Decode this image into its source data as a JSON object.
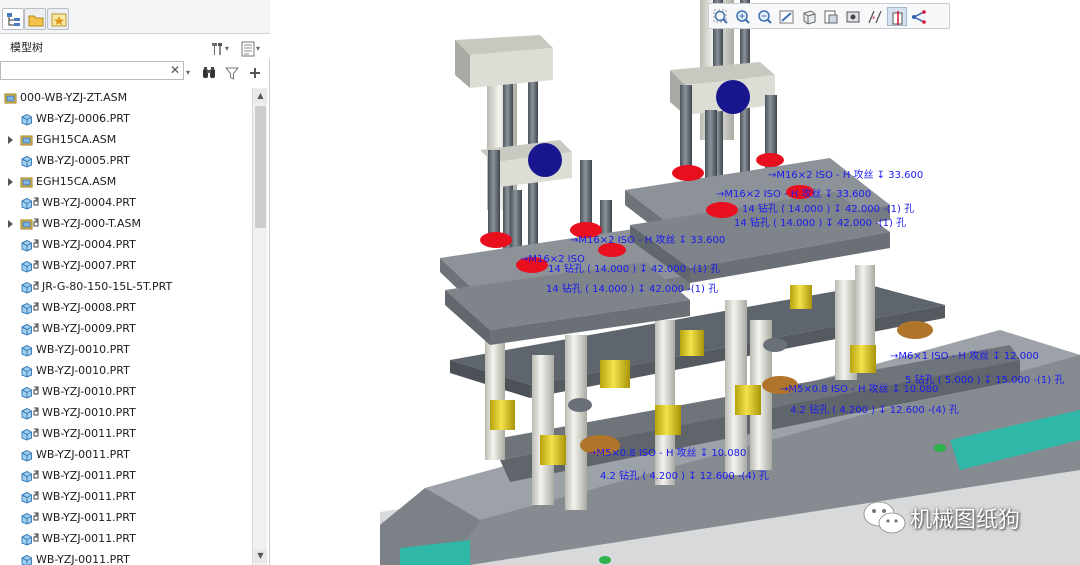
{
  "panel": {
    "title": "模型树",
    "search_value": "",
    "tabs": [
      "model-tree-tab",
      "folder-browser-tab",
      "favorites-tab"
    ]
  },
  "tree": {
    "items": [
      {
        "label": "000-WB-YZJ-ZT.ASM",
        "type": "asm",
        "expandable": false
      },
      {
        "label": "WB-YZJ-0006.PRT",
        "type": "prt",
        "expandable": false
      },
      {
        "label": "EGH15CA.ASM",
        "type": "asm",
        "expandable": true
      },
      {
        "label": "WB-YZJ-0005.PRT",
        "type": "prt",
        "expandable": false
      },
      {
        "label": "EGH15CA.ASM",
        "type": "asm",
        "expandable": true
      },
      {
        "label": "WB-YZJ-0004.PRT",
        "type": "prt-link",
        "expandable": false
      },
      {
        "label": "WB-YZJ-000-T.ASM",
        "type": "asm-link",
        "expandable": true
      },
      {
        "label": "WB-YZJ-0004.PRT",
        "type": "prt-link",
        "expandable": false
      },
      {
        "label": "WB-YZJ-0007.PRT",
        "type": "prt-link",
        "expandable": false
      },
      {
        "label": "JR-G-80-150-15L-5T.PRT",
        "type": "prt-link",
        "expandable": false
      },
      {
        "label": "WB-YZJ-0008.PRT",
        "type": "prt-link",
        "expandable": false
      },
      {
        "label": "WB-YZJ-0009.PRT",
        "type": "prt-link",
        "expandable": false
      },
      {
        "label": "WB-YZJ-0010.PRT",
        "type": "prt",
        "expandable": false
      },
      {
        "label": "WB-YZJ-0010.PRT",
        "type": "prt",
        "expandable": false
      },
      {
        "label": "WB-YZJ-0010.PRT",
        "type": "prt-link",
        "expandable": false
      },
      {
        "label": "WB-YZJ-0010.PRT",
        "type": "prt-link",
        "expandable": false
      },
      {
        "label": "WB-YZJ-0011.PRT",
        "type": "prt-link",
        "expandable": false
      },
      {
        "label": "WB-YZJ-0011.PRT",
        "type": "prt",
        "expandable": false
      },
      {
        "label": "WB-YZJ-0011.PRT",
        "type": "prt-link",
        "expandable": false
      },
      {
        "label": "WB-YZJ-0011.PRT",
        "type": "prt-link",
        "expandable": false
      },
      {
        "label": "WB-YZJ-0011.PRT",
        "type": "prt-link",
        "expandable": false
      },
      {
        "label": "WB-YZJ-0011.PRT",
        "type": "prt-link",
        "expandable": false
      },
      {
        "label": "WB-YZJ-0011.PRT",
        "type": "prt",
        "expandable": false
      }
    ]
  },
  "viewport": {
    "toolbar": [
      "refit-icon",
      "zoom-in-icon",
      "zoom-out-icon",
      "repaint-icon",
      "display-style-icon",
      "saved-views-icon",
      "view-manager-icon",
      "annotation-display-icon",
      "datum-display-icon",
      "spin-center-icon",
      "csys-display-icon"
    ],
    "annotations": [
      {
        "text": "→M16×2 ISO - H 攻丝 ↧ 33.600"
      },
      {
        "text": "14 钻孔 ( 14.000 ) ↧ 42.000 -(1) 孔"
      },
      {
        "text": "→M16×2 ISO - H 攻丝 ↧ 33.600"
      },
      {
        "text": "14 钻孔 ( 14.000 ) ↧ 42.000 -(1) 孔"
      },
      {
        "text": "→M16×2 ISO"
      },
      {
        "text": "14 钻孔 ( 14.000 ) ↧ 42.000 -(1) 孔"
      },
      {
        "text": "→M16×2 ISO - H 攻丝 ↧ 33.600"
      },
      {
        "text": "14 钻孔 ( 14.000 ) ↧ 42.000 -(1) 孔"
      },
      {
        "text": "→M5×0.8 ISO - H 攻丝 ↧ 10.080"
      },
      {
        "text": "4.2 钻孔 ( 4.200 ) ↧ 12.600 -(4) 孔"
      },
      {
        "text": "→M5×0.8 ISO - H 攻丝 ↧ 10.080"
      },
      {
        "text": "4.2 钻孔 ( 4.200 ) ↧ 12.600 -(4) 孔"
      },
      {
        "text": "→M6×1 ISO - H 攻丝 ↧ 12.000"
      },
      {
        "text": "5 钻孔 ( 5.000 ) ↧ 15.000 -(1) 孔"
      }
    ],
    "watermark": "机械图纸狗"
  },
  "colors": {
    "annotation": "#1a1aee",
    "plate": "#7a8088",
    "rod": "#5f6670",
    "cylinder": "#e2e2da",
    "red": "#e8101e",
    "yellow": "#e6d21a",
    "blue": "#17168f",
    "base": "#8d9196",
    "teal": "#2fb8a8"
  }
}
